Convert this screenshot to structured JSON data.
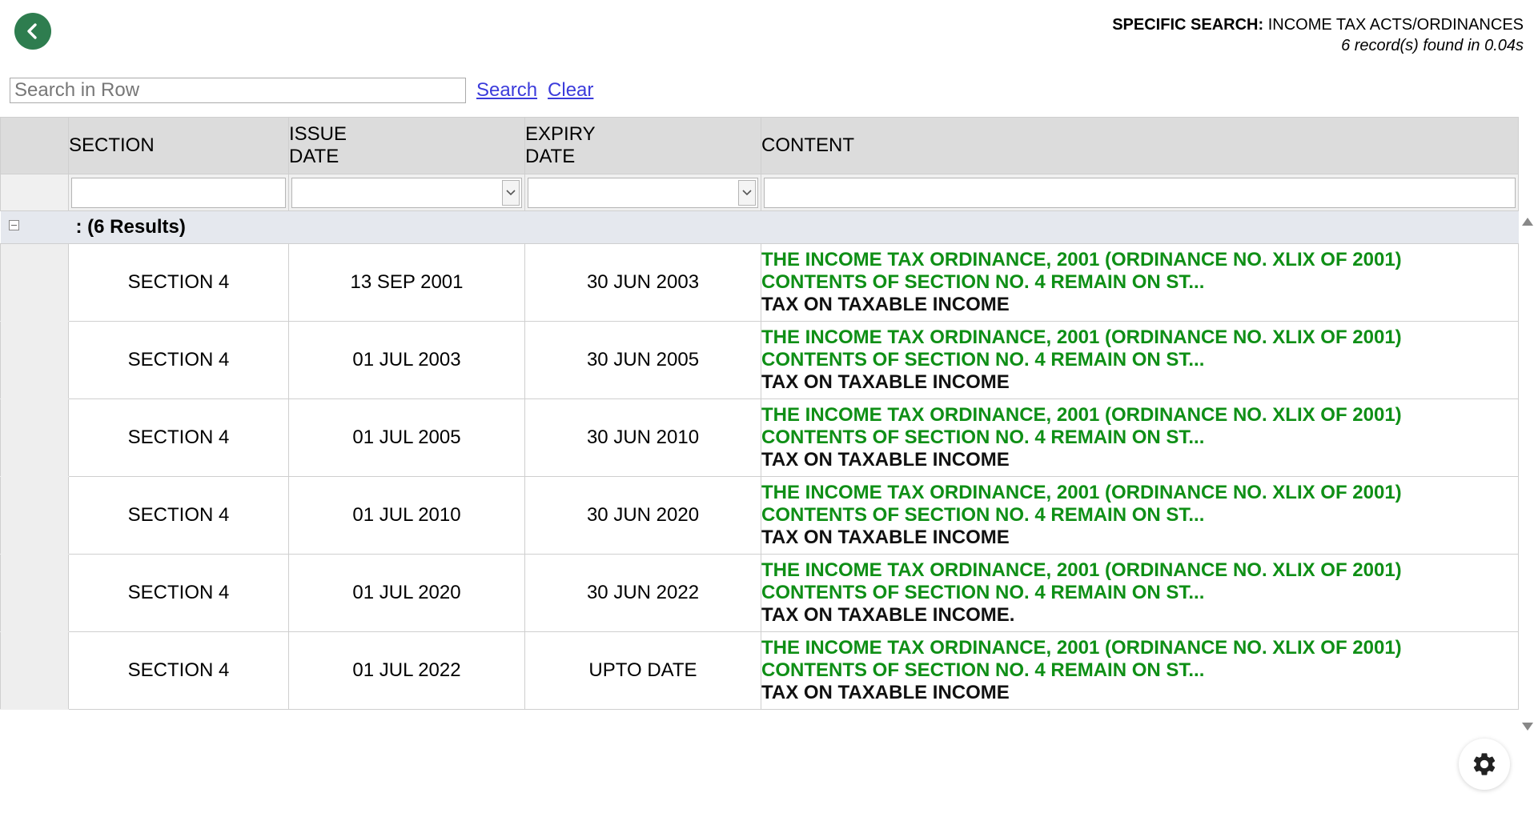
{
  "header": {
    "search_label": "SPECIFIC SEARCH:",
    "search_value": "INCOME TAX ACTS/ORDINANCES",
    "record_count": "6 record(s) found in 0.04s"
  },
  "search": {
    "placeholder": "Search in Row",
    "value": "",
    "search_link": "Search",
    "clear_link": "Clear"
  },
  "columns": {
    "section": "SECTION",
    "issue_line1": "ISSUE",
    "issue_line2": "DATE",
    "expiry_line1": "EXPIRY",
    "expiry_line2": "DATE",
    "content": "CONTENT"
  },
  "group": {
    "label": ": (6 Results)"
  },
  "rows": [
    {
      "section": "SECTION 4",
      "issue": "13 SEP 2001",
      "expiry": "30 JUN 2003",
      "content_line1": "THE INCOME TAX ORDINANCE, 2001 (ORDINANCE NO. XLIX OF 2001)",
      "content_line2": "CONTENTS OF SECTION NO. 4 REMAIN ON ST...",
      "content_line3": "TAX ON TAXABLE INCOME"
    },
    {
      "section": "SECTION 4",
      "issue": "01 JUL 2003",
      "expiry": "30 JUN 2005",
      "content_line1": "THE INCOME TAX ORDINANCE, 2001 (ORDINANCE NO. XLIX OF 2001)",
      "content_line2": "CONTENTS OF SECTION NO. 4 REMAIN ON ST...",
      "content_line3": "TAX ON TAXABLE INCOME"
    },
    {
      "section": "SECTION 4",
      "issue": "01 JUL 2005",
      "expiry": "30 JUN 2010",
      "content_line1": "THE INCOME TAX ORDINANCE, 2001 (ORDINANCE NO. XLIX OF 2001)",
      "content_line2": "CONTENTS OF SECTION NO. 4 REMAIN ON ST...",
      "content_line3": "TAX ON TAXABLE INCOME"
    },
    {
      "section": "SECTION 4",
      "issue": "01 JUL 2010",
      "expiry": "30 JUN 2020",
      "content_line1": "THE INCOME TAX ORDINANCE, 2001 (ORDINANCE NO. XLIX OF 2001)",
      "content_line2": "CONTENTS OF SECTION NO. 4 REMAIN ON ST...",
      "content_line3": "TAX ON TAXABLE INCOME"
    },
    {
      "section": "SECTION 4",
      "issue": "01 JUL 2020",
      "expiry": "30 JUN 2022",
      "content_line1": "THE INCOME TAX ORDINANCE, 2001 (ORDINANCE NO. XLIX OF 2001)",
      "content_line2": "CONTENTS OF SECTION NO. 4 REMAIN ON ST...",
      "content_line3": "TAX ON TAXABLE INCOME."
    },
    {
      "section": "SECTION 4",
      "issue": "01 JUL 2022",
      "expiry": "UPTO DATE",
      "content_line1": "THE INCOME TAX ORDINANCE, 2001 (ORDINANCE NO. XLIX OF 2001)",
      "content_line2": "CONTENTS OF SECTION NO. 4 REMAIN ON ST...",
      "content_line3": "TAX ON TAXABLE INCOME"
    }
  ],
  "icons": {
    "back": "chevron-left-icon",
    "collapse": "minus-box-icon",
    "dropdown": "chevron-down-icon",
    "settings": "gear-icon"
  },
  "colors": {
    "accent_green": "#2e7d4f",
    "content_green": "#0f8f16",
    "link_blue": "#3b3bdb"
  }
}
